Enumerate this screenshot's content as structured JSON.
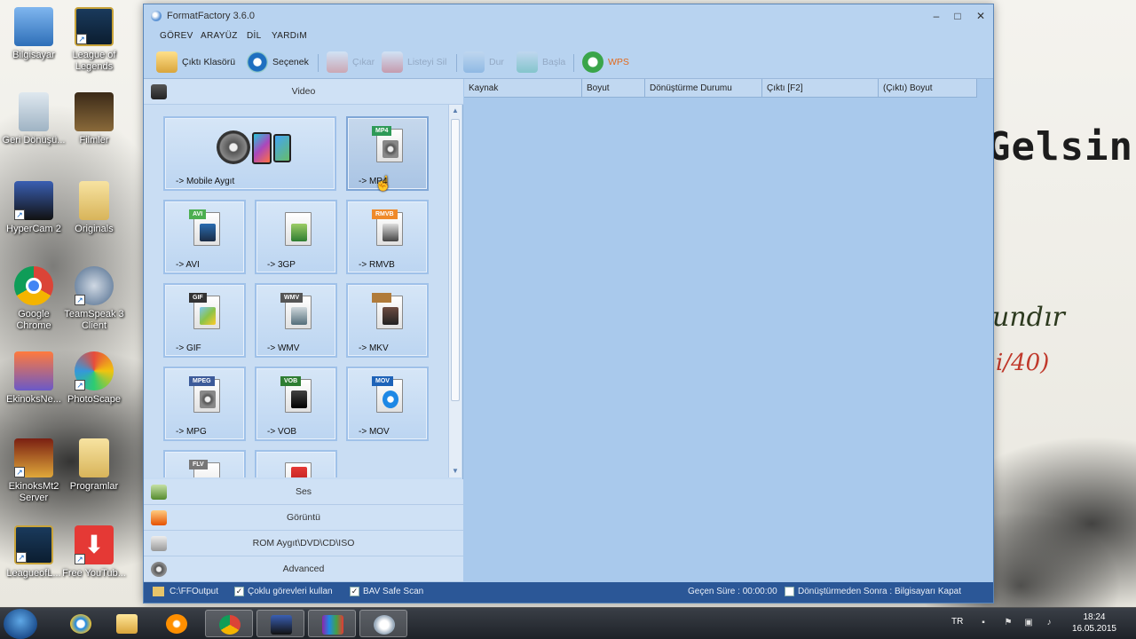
{
  "window": {
    "title": "FormatFactory 3.6.0",
    "min": "‒",
    "max": "□",
    "close": "✕"
  },
  "menu": [
    "GÖREV",
    "ARAYÜZ",
    "DİL",
    "YARDıM"
  ],
  "toolbar": {
    "output_folder": "Çıktı Klasörü",
    "options": "Seçenek",
    "remove": "Çıkar",
    "clear_list": "Listeyi Sil",
    "stop": "Dur",
    "start": "Başla",
    "wps": "WPS"
  },
  "categories": {
    "video": "Video",
    "audio": "Ses",
    "image": "Görüntü",
    "rom": "ROM Aygıt\\DVD\\CD\\ISO",
    "advanced": "Advanced"
  },
  "formats": [
    {
      "label": "-> Mobile Aygıt"
    },
    {
      "label": "-> MP4",
      "tag": "MP4"
    },
    {
      "label": "-> AVI",
      "tag": "AVI"
    },
    {
      "label": "-> 3GP",
      "tag": ""
    },
    {
      "label": "-> RMVB",
      "tag": "RMVB"
    },
    {
      "label": "-> GIF",
      "tag": "GIF"
    },
    {
      "label": "-> WMV",
      "tag": "WMV"
    },
    {
      "label": "-> MKV",
      "tag": ""
    },
    {
      "label": "-> MPG",
      "tag": "MPEG"
    },
    {
      "label": "-> VOB",
      "tag": "VOB"
    },
    {
      "label": "-> MOV",
      "tag": "MOV"
    },
    {
      "label": "",
      "tag": "FLV"
    },
    {
      "label": "",
      "tag": ""
    }
  ],
  "list_headers": [
    "Kaynak",
    "Boyut",
    "Dönüştürme Durumu",
    "Çıktı [F2]",
    "(Çıktı) Boyut"
  ],
  "status": {
    "folder": "C:\\FFOutput",
    "multi": "Çoklu görevleri kullan",
    "bav": "BAV Safe Scan",
    "elapsed": "Geçen Süre : 00:00:00",
    "after": "Dönüştürmeden Sonra : Bilgisayarı Kapat"
  },
  "desktop": [
    {
      "label": "Bilgisayar"
    },
    {
      "label": "League of Legends"
    },
    {
      "label": "Geri Dönüşü..."
    },
    {
      "label": "Filmler"
    },
    {
      "label": "HyperCam 2"
    },
    {
      "label": "Originals"
    },
    {
      "label": "Google Chrome"
    },
    {
      "label": "TeamSpeak 3 Client"
    },
    {
      "label": "EkinoksNe..."
    },
    {
      "label": "PhotoScape"
    },
    {
      "label": "EkinoksMt2 Server"
    },
    {
      "label": "Programlar"
    },
    {
      "label": "LeagueofL..."
    },
    {
      "label": "Free YouTub..."
    }
  ],
  "wallpaper": {
    "line1": "Gelsin",
    "line2": "undır",
    "line3": "i/40)"
  },
  "taskbar": {
    "lang": "TR",
    "time": "18:24",
    "date": "16.05.2015"
  }
}
